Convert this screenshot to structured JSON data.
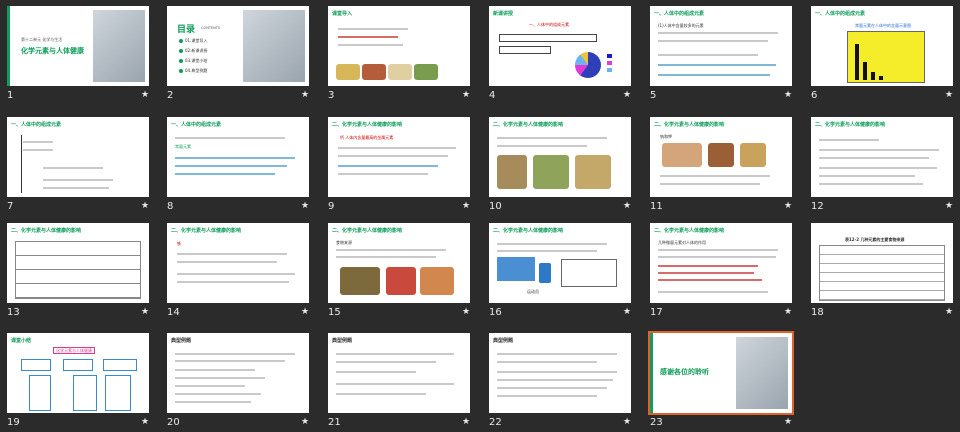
{
  "slides": [
    {
      "n": "1",
      "title": "化学元素与人体健康",
      "sub": "第十二单元 化学与生活"
    },
    {
      "n": "2",
      "heading": "目录",
      "contents": "CONTENTS",
      "items": [
        "01.课堂导入",
        "02.新课讲授",
        "03.课堂小结",
        "04.典型例题"
      ]
    },
    {
      "n": "3",
      "title": "课堂导入"
    },
    {
      "n": "4",
      "title": "新课讲授",
      "label": "一、人体中的组成元素"
    },
    {
      "n": "5",
      "title": "一、人体中的组成元素",
      "label": "(1)人体中含量较多的元素"
    },
    {
      "n": "6",
      "title": "一、人体中的组成元素",
      "label": "常量元素在人体中的含量示意图"
    },
    {
      "n": "7",
      "title": "一、人体中的组成元素"
    },
    {
      "n": "8",
      "title": "一、人体中的组成元素",
      "label": "常量元素"
    },
    {
      "n": "9",
      "title": "二、化学元素与人体健康的影响",
      "label": "钙 人体内含量最高的金属元素"
    },
    {
      "n": "10",
      "title": "二、化学元素与人体健康的影响"
    },
    {
      "n": "11",
      "title": "二、化学元素与人体健康的影响",
      "label": "钠和钾"
    },
    {
      "n": "12",
      "title": "二、化学元素与人体健康的影响"
    },
    {
      "n": "13",
      "title": "二、化学元素与人体健康的影响"
    },
    {
      "n": "14",
      "title": "二、化学元素与人体健康的影响",
      "label": "铁"
    },
    {
      "n": "15",
      "title": "二、化学元素与人体健康的影响",
      "label": "食物来源"
    },
    {
      "n": "16",
      "title": "二、化学元素与人体健康的影响",
      "label": "运动员"
    },
    {
      "n": "17",
      "title": "二、化学元素与人体健康的影响",
      "label": "几种微量元素对人体的作用"
    },
    {
      "n": "18",
      "title": "二、化学元素与人体健康的影响",
      "label": "表12-2 几种元素的主要食物来源"
    },
    {
      "n": "19",
      "title": "课堂小结",
      "label": "化学元素与人体健康"
    },
    {
      "n": "20",
      "title": "典型例题"
    },
    {
      "n": "21",
      "title": "典型例题"
    },
    {
      "n": "22",
      "title": "典型例题"
    },
    {
      "n": "23",
      "title": "感谢各位的聆听"
    }
  ],
  "star": "★"
}
